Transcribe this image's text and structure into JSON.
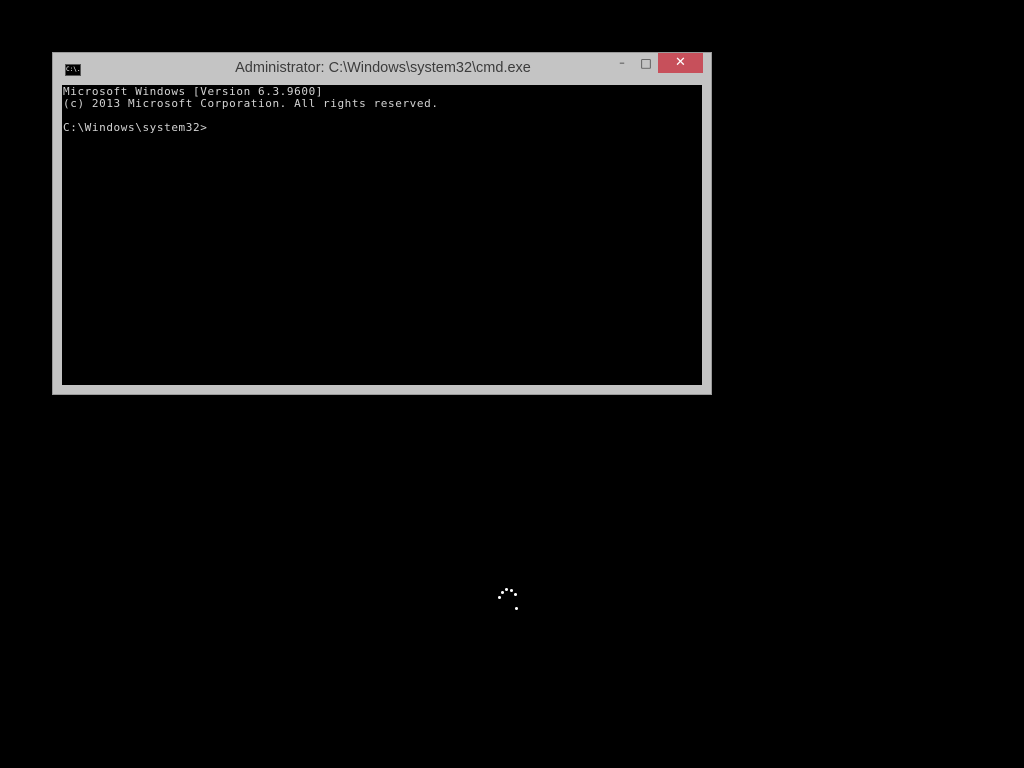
{
  "window": {
    "title": "Administrator: C:\\Windows\\system32\\cmd.exe",
    "icon": "cmd-icon",
    "icon_text": "C:\\.",
    "minimize_label": "–",
    "maximize_label": "□",
    "close_label": "✕",
    "close_color": "#c7505b"
  },
  "console": {
    "lines": [
      "Microsoft Windows [Version 6.3.9600]",
      "(c) 2013 Microsoft Corporation. All rights reserved.",
      "C:\\Windows\\system32>"
    ],
    "text_color": "#d2d2d2",
    "background": "#000000"
  },
  "spinner": {
    "icon": "loading-spinner-icon"
  }
}
